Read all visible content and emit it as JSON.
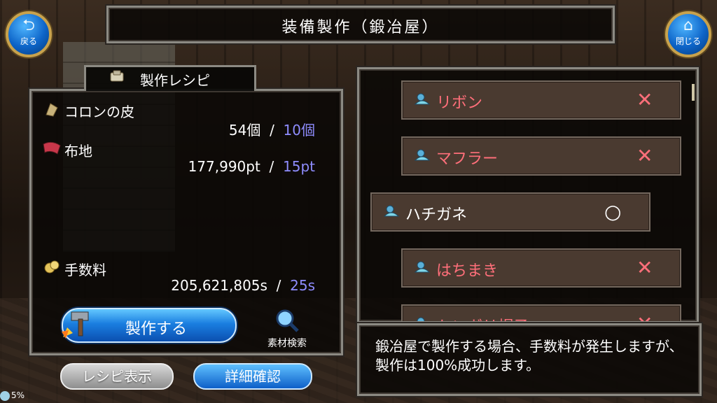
{
  "title": "装備製作（鍛冶屋）",
  "nav": {
    "back": {
      "label": "戻る",
      "icon": "back-arrow-icon"
    },
    "close": {
      "label": "閉じる",
      "icon": "home-icon"
    }
  },
  "recipe": {
    "header": "製作レシピ",
    "materials": [
      {
        "name": "コロンの皮",
        "have": "54個",
        "sep": "/",
        "need": "10個",
        "icon": "hide-icon"
      },
      {
        "name": "布地",
        "have": "177,990pt",
        "sep": "/",
        "need": "15pt",
        "icon": "cloth-icon"
      }
    ],
    "fee": {
      "name": "手数料",
      "have": "205,621,805s",
      "sep": "/",
      "need": "25s",
      "icon": "coins-icon"
    },
    "make_button": "製作する",
    "search_label": "素材検索",
    "recipe_view": "レシピ表示",
    "detail_confirm": "詳細確認"
  },
  "status": {
    "percent": "5%"
  },
  "list": {
    "items": [
      {
        "name": "リボン",
        "mark": "✕",
        "available": false
      },
      {
        "name": "マフラー",
        "mark": "✕",
        "available": false
      },
      {
        "name": "ハチガネ",
        "mark": "○",
        "available": true
      },
      {
        "name": "はちまき",
        "mark": "✕",
        "available": false
      },
      {
        "name": "トンガリ帽子",
        "mark": "✕",
        "available": false
      }
    ]
  },
  "message": "鍛冶屋で製作する場合、手数料が発生しますが、製作は100%成功します。",
  "colors": {
    "need": "#8f8dff",
    "unavailable": "#ff6f7a",
    "button_blue": "#1a7ee0"
  }
}
